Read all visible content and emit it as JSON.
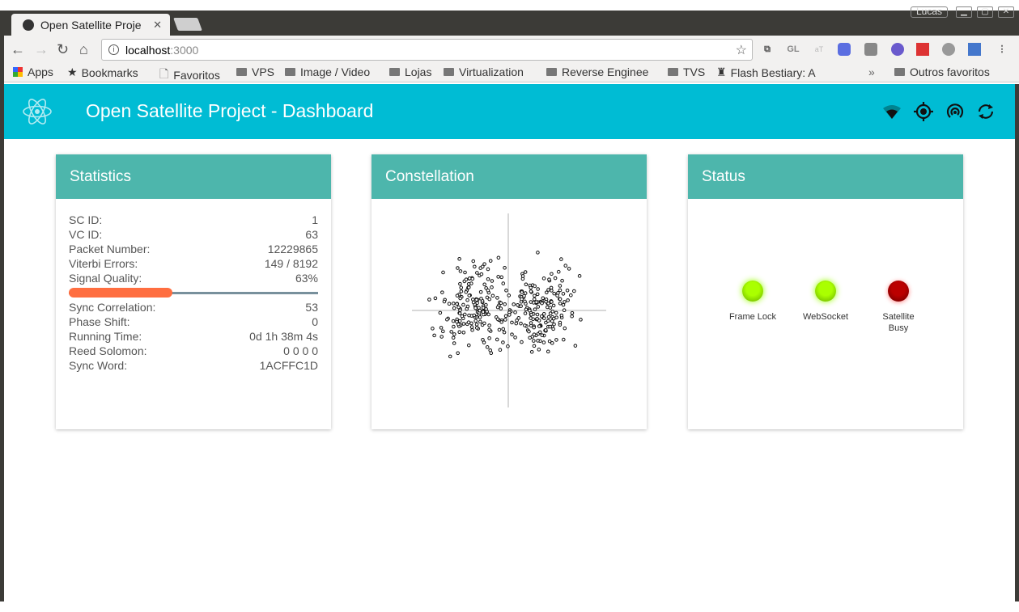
{
  "browser": {
    "tab_title": "Open Satellite Proje",
    "user": "Lucas",
    "url_host": "localhost",
    "url_port": ":3000",
    "extensions": [
      "GL",
      "aT"
    ],
    "bookmarks": [
      "Apps",
      "Bookmarks",
      "Favoritos",
      "VPS",
      "Image / Video",
      "Lojas",
      "Virtualization",
      "Reverse Enginee",
      "TVS",
      "Flash Bestiary: A"
    ],
    "other_bookmarks": "Outros favoritos"
  },
  "header": {
    "title": "Open Satellite Project - Dashboard",
    "icons": [
      "react-logo-icon",
      "wifi-icon",
      "gps-icon",
      "broadcast-icon",
      "sync-icon"
    ],
    "color": "#00bcd4"
  },
  "statistics": {
    "title": "Statistics",
    "rows_top": [
      {
        "label": "SC ID:",
        "value": "1"
      },
      {
        "label": "VC ID:",
        "value": "63"
      },
      {
        "label": "Packet Number:",
        "value": "12229865"
      },
      {
        "label": "Viterbi Errors:",
        "value": "149 / 8192"
      },
      {
        "label": "Signal Quality:",
        "value": "63%"
      }
    ],
    "signal_quality_percent": 63,
    "rows_bottom": [
      {
        "label": "Sync Correlation:",
        "value": "53"
      },
      {
        "label": "Phase Shift:",
        "value": "0"
      },
      {
        "label": "Running Time:",
        "value": "0d 1h 38m 4s"
      },
      {
        "label": "Reed Solomon:",
        "value": "0 0 0 0"
      },
      {
        "label": "Sync Word:",
        "value": "1ACFFC1D"
      }
    ]
  },
  "constellation": {
    "title": "Constellation",
    "type": "scatter"
  },
  "status": {
    "title": "Status",
    "indicators": [
      {
        "label": "Frame Lock",
        "state": "on",
        "color": "#aaff00"
      },
      {
        "label": "WebSocket",
        "state": "on",
        "color": "#aaff00"
      },
      {
        "label": "Satellite Busy",
        "state": "on",
        "color": "#aa0000"
      }
    ]
  },
  "colors": {
    "card_header": "#4db6ac",
    "progress": "#ff6e40"
  }
}
